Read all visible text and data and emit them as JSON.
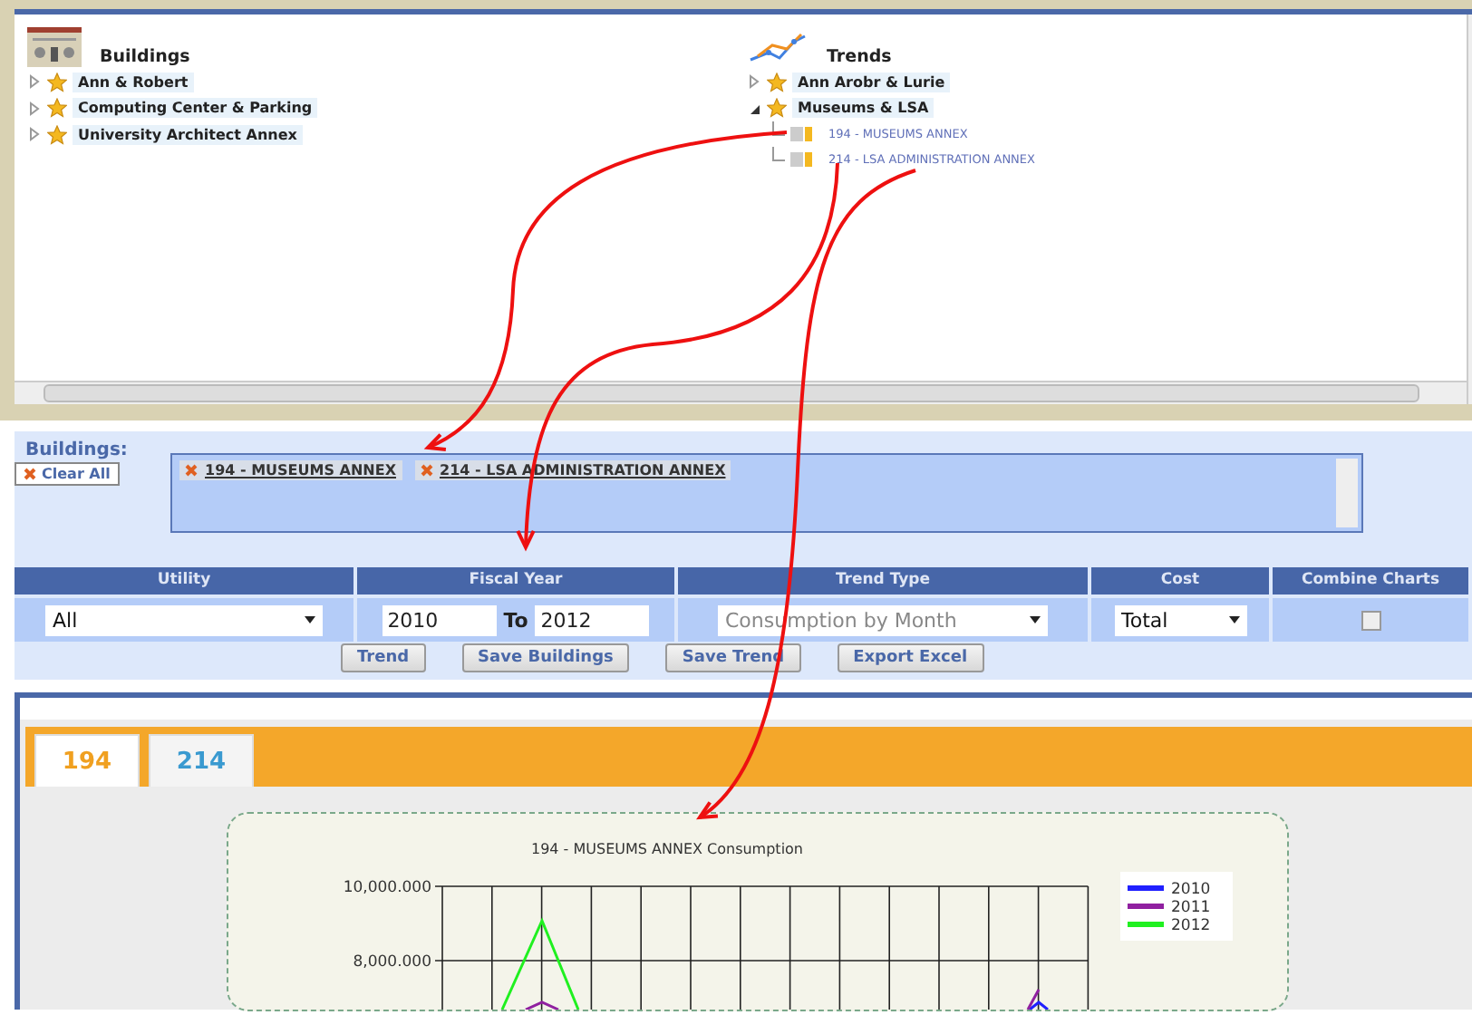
{
  "buildings_tree": {
    "title": "Buildings",
    "items": [
      {
        "label": "Ann & Robert",
        "expanded": false
      },
      {
        "label": "Computing Center & Parking",
        "expanded": false
      },
      {
        "label": "University Architect Annex",
        "expanded": false
      }
    ]
  },
  "trends_tree": {
    "title": "Trends",
    "items": [
      {
        "label": "Ann Arobr & Lurie",
        "expanded": false
      },
      {
        "label": "Museums & LSA",
        "expanded": true,
        "children": [
          {
            "label": "194 - MUSEUMS ANNEX"
          },
          {
            "label": "214 - LSA ADMINISTRATION ANNEX"
          }
        ]
      }
    ]
  },
  "selection": {
    "label": "Buildings:",
    "clear_button": "Clear All",
    "chips": [
      "194 - MUSEUMS ANNEX",
      "214 - LSA ADMINISTRATION ANNEX"
    ]
  },
  "filters": {
    "columns": [
      "Utility",
      "Fiscal Year",
      "Trend Type",
      "Cost",
      "Combine Charts"
    ],
    "utility": "All",
    "year_from": "2010",
    "to_label": "To",
    "year_to": "2012",
    "trend_type": {
      "value": "Consumption by Month",
      "disabled": true
    },
    "cost": "Total",
    "combine_charts": false
  },
  "buttons": [
    "Trend",
    "Save Buildings",
    "Save Trend",
    "Export Excel"
  ],
  "chart_tabs": [
    {
      "label": "194",
      "selected": true
    },
    {
      "label": "214",
      "selected": false
    }
  ],
  "chart": {
    "title": "194 - MUSEUMS ANNEX Consumption",
    "y_labels": [
      "10,000.000",
      "8,000.000"
    ],
    "legend": [
      {
        "name": "2010",
        "color": "#2020ff"
      },
      {
        "name": "2011",
        "color": "#9020a0"
      },
      {
        "name": "2012",
        "color": "#20f020"
      }
    ]
  }
}
